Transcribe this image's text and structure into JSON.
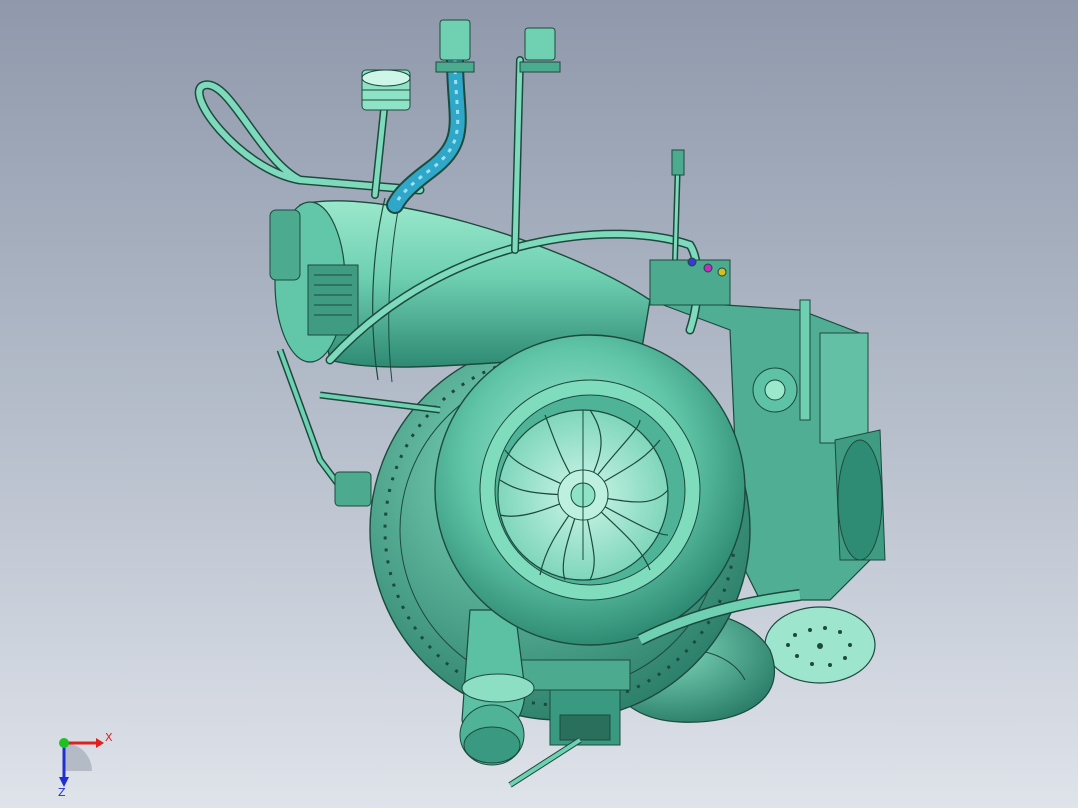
{
  "viewport": {
    "background_top": "#8f99ab",
    "background_bottom": "#dfe3ea"
  },
  "model": {
    "body_color": "#59c2a4",
    "highlight_color": "#9be8cc",
    "shadow_color": "#2e8a73",
    "edge_color": "#1c4a3d",
    "hose_color": "#2fa7c9"
  },
  "triad": {
    "x_label": "X",
    "z_label": "Z",
    "x_color": "#e02020",
    "y_color": "#20c020",
    "z_color": "#2030d0"
  }
}
